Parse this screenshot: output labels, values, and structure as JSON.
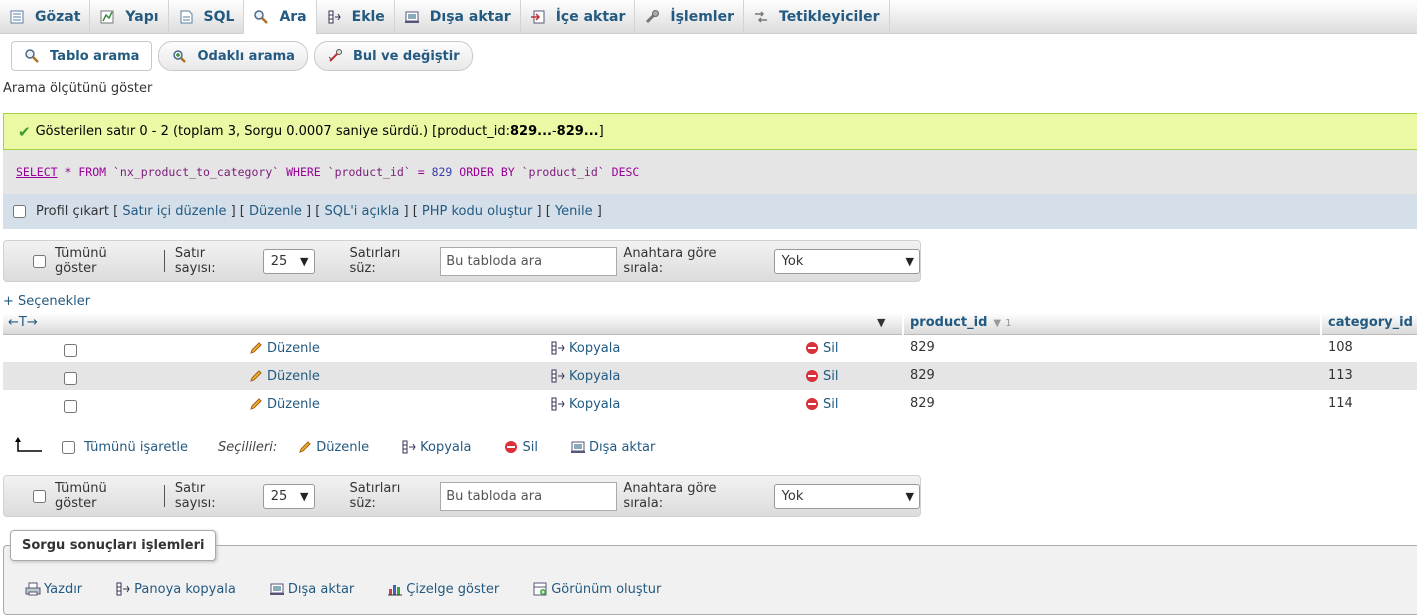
{
  "tabs": [
    {
      "label": "Gözat",
      "icon": "browse-icon"
    },
    {
      "label": "Yapı",
      "icon": "structure-icon"
    },
    {
      "label": "SQL",
      "icon": "sql-icon"
    },
    {
      "label": "Ara",
      "icon": "search-icon",
      "active": true
    },
    {
      "label": "Ekle",
      "icon": "insert-icon"
    },
    {
      "label": "Dışa aktar",
      "icon": "export-icon"
    },
    {
      "label": "İçe aktar",
      "icon": "import-icon"
    },
    {
      "label": "İşlemler",
      "icon": "operations-icon"
    },
    {
      "label": "Tetikleyiciler",
      "icon": "triggers-icon"
    }
  ],
  "subtabs": [
    {
      "label": "Tablo arama",
      "icon": "table-search-icon"
    },
    {
      "label": "Odaklı arama",
      "icon": "zoom-search-icon"
    },
    {
      "label": "Bul ve değiştir",
      "icon": "find-replace-icon"
    }
  ],
  "criteria_link": "Arama ölçütünü göster",
  "success": {
    "text_prefix": "Gösterilen satır 0 - 2 (toplam 3, Sorgu 0.0007 saniye sürdü.) [product_id: ",
    "bold1": "829...",
    "mid": " - ",
    "bold2": "829...",
    "suffix": "]"
  },
  "sql": {
    "select": "SELECT",
    "star": "*",
    "from": "FROM",
    "table": "`nx_product_to_category`",
    "where": "WHERE",
    "col": "`product_id`",
    "eq": "=",
    "val": "829",
    "order": "ORDER BY",
    "col2": "`product_id`",
    "desc": "DESC"
  },
  "sql_actions": {
    "profile": "Profil çıkart",
    "links": [
      "Satır içi düzenle",
      "Düzenle",
      "SQL'i açıkla",
      "PHP kodu oluştur",
      "Yenile"
    ]
  },
  "nav": {
    "show_all": "Tümünü göster",
    "rows_label": "Satır sayısı:",
    "rows_value": "25",
    "filter_label": "Satırları süz:",
    "filter_placeholder": "Bu tabloda ara",
    "sort_label": "Anahtara göre sırala:",
    "sort_value": "Yok"
  },
  "options_link": "+ Seçenekler",
  "table": {
    "arrows": "←T→",
    "columns": [
      "product_id",
      "category_id"
    ],
    "sort_index": "1",
    "actions": {
      "edit": "Düzenle",
      "copy": "Kopyala",
      "delete": "Sil"
    },
    "rows": [
      {
        "product_id": "829",
        "category_id": "108"
      },
      {
        "product_id": "829",
        "category_id": "113"
      },
      {
        "product_id": "829",
        "category_id": "114"
      }
    ]
  },
  "bulk": {
    "check_all": "Tümünü işaretle",
    "selected": "Seçilileri:",
    "edit": "Düzenle",
    "copy": "Kopyala",
    "delete": "Sil",
    "export": "Dışa aktar"
  },
  "query_ops": {
    "legend": "Sorgu sonuçları işlemleri",
    "items": [
      {
        "label": "Yazdır",
        "icon": "print-icon"
      },
      {
        "label": "Panoya kopyala",
        "icon": "clipboard-icon"
      },
      {
        "label": "Dışa aktar",
        "icon": "export-icon"
      },
      {
        "label": "Çizelge göster",
        "icon": "chart-icon"
      },
      {
        "label": "Görünüm oluştur",
        "icon": "view-icon"
      }
    ]
  },
  "colors": {
    "link": "#235a81",
    "success_bg": "#ebf8a4",
    "sql_bg": "#e5e5e5",
    "actions_bg": "#d5dfe9"
  }
}
